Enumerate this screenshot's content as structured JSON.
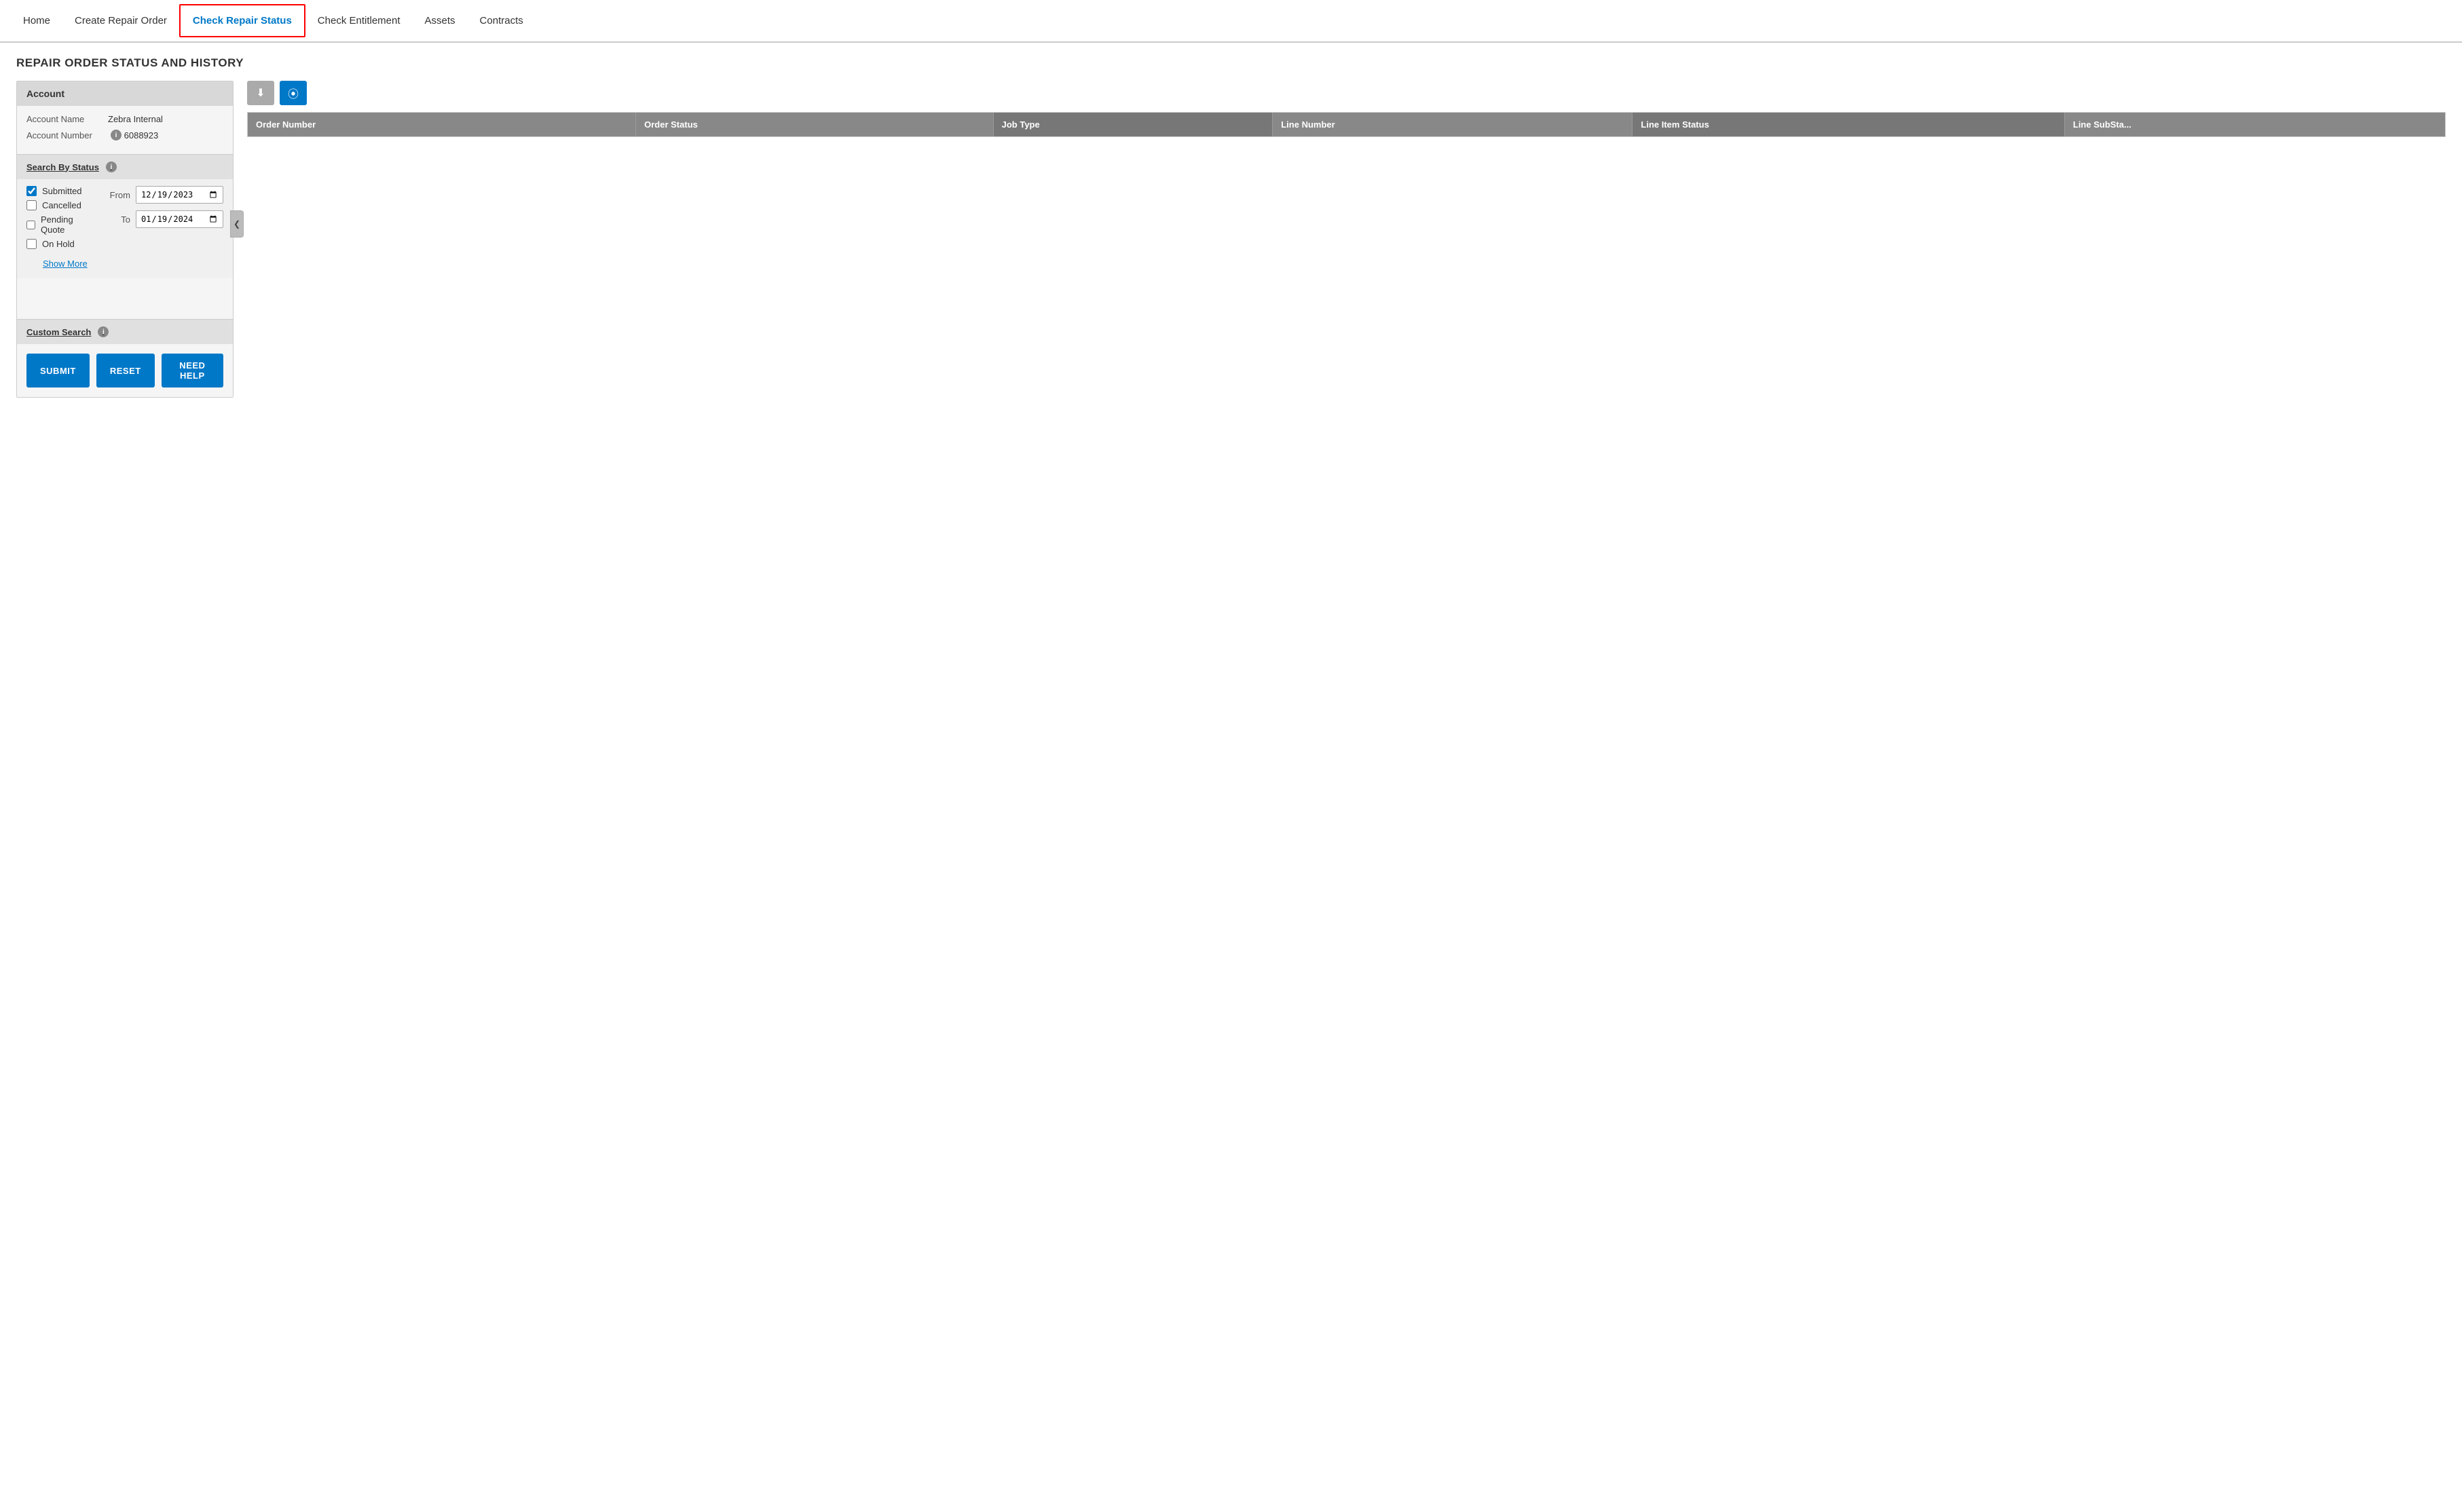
{
  "nav": {
    "items": [
      {
        "id": "home",
        "label": "Home",
        "active": false
      },
      {
        "id": "create-repair-order",
        "label": "Create Repair Order",
        "active": false
      },
      {
        "id": "check-repair-status",
        "label": "Check Repair Status",
        "active": true
      },
      {
        "id": "check-entitlement",
        "label": "Check Entitlement",
        "active": false
      },
      {
        "id": "assets",
        "label": "Assets",
        "active": false
      },
      {
        "id": "contracts",
        "label": "Contracts",
        "active": false
      }
    ]
  },
  "page": {
    "title": "REPAIR ORDER STATUS AND HISTORY"
  },
  "account": {
    "section_label": "Account",
    "account_name_label": "Account Name",
    "account_name_value": "Zebra Internal",
    "account_number_label": "Account Number",
    "account_number_value": "6088923"
  },
  "search_by_status": {
    "label": "Search By Status",
    "checkboxes": [
      {
        "id": "submitted",
        "label": "Submitted",
        "checked": true
      },
      {
        "id": "cancelled",
        "label": "Cancelled",
        "checked": false
      },
      {
        "id": "pending-quote",
        "label": "Pending Quote",
        "checked": false
      },
      {
        "id": "on-hold",
        "label": "On Hold",
        "checked": false
      }
    ],
    "from_label": "From",
    "to_label": "To",
    "from_date": "12/19/2023",
    "to_date": "01/19/2024",
    "show_more_label": "Show More"
  },
  "custom_search": {
    "label": "Custom Search"
  },
  "buttons": {
    "submit": "SUBMIT",
    "reset": "RESET",
    "need_help": "NEED HELP"
  },
  "toolbar": {
    "download_icon": "⬇",
    "columns_icon": "⦿"
  },
  "table": {
    "columns": [
      "Order Number",
      "Order Status",
      "Job Type",
      "Line Number",
      "Line Item Status",
      "Line SubSta..."
    ],
    "rows": []
  },
  "icons": {
    "info": "i",
    "collapse": "❮"
  }
}
